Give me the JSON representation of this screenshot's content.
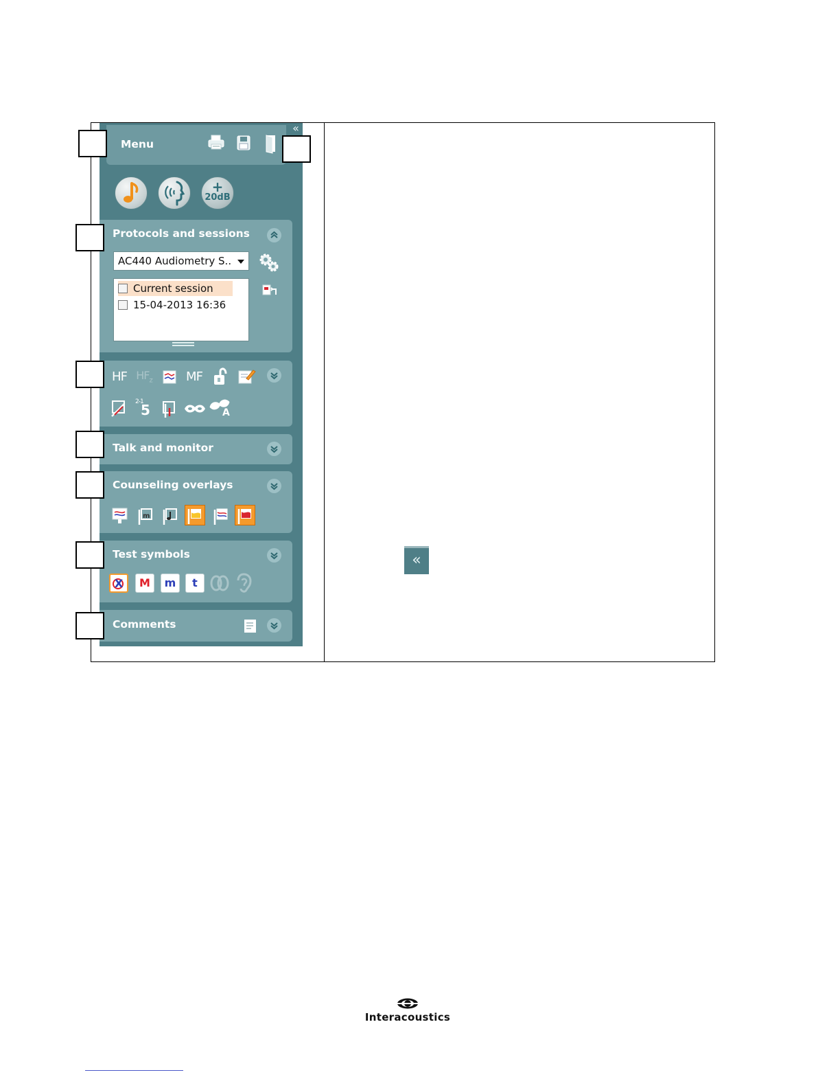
{
  "panel": {
    "collapse_glyph": "«",
    "menu": {
      "label": "Menu",
      "icons": [
        "printer-icon",
        "save-icon",
        "exit-door-icon"
      ]
    },
    "mode_buttons": [
      {
        "name": "tone-audiometry-button",
        "icon": "music-note-icon"
      },
      {
        "name": "speech-audiometry-button",
        "icon": "speaking-head-icon"
      },
      {
        "name": "plus-20db-button",
        "label_top": "+",
        "label_bottom": "20dB"
      }
    ],
    "protocols": {
      "title": "Protocols and sessions",
      "chevron": "«",
      "dropdown_value": "AC440 Audiometry S..",
      "sessions": [
        {
          "label": "Current session",
          "selected": true
        },
        {
          "label": "15-04-2013 16:36",
          "selected": false
        }
      ]
    },
    "tools": {
      "chevron": "»",
      "row1_text": {
        "hf": "HF",
        "hfz": "HF",
        "hfz_sub": "z",
        "mf": "MF"
      },
      "row2_text": {
        "sym_top": "2-1",
        "sym_main": "5",
        "a_mark": "A"
      }
    },
    "talk_monitor": {
      "title": "Talk and monitor",
      "chevron": "»"
    },
    "counseling": {
      "title": "Counseling overlays",
      "chevron": "»"
    },
    "test_symbols": {
      "title": "Test symbols",
      "chevron": "»",
      "symbols": [
        "X",
        "M",
        "m",
        "t"
      ]
    },
    "comments": {
      "title": "Comments",
      "chevron": "»"
    }
  },
  "expander": {
    "glyph": "«"
  },
  "brand": {
    "name": "Interacoustics"
  },
  "colors": {
    "panel_dark": "#4f7f87",
    "panel_section": "#7ba4aa",
    "accent_orange": "#f49a2c",
    "symbol_red": "#e0202a",
    "symbol_blue": "#2d3fb8"
  }
}
